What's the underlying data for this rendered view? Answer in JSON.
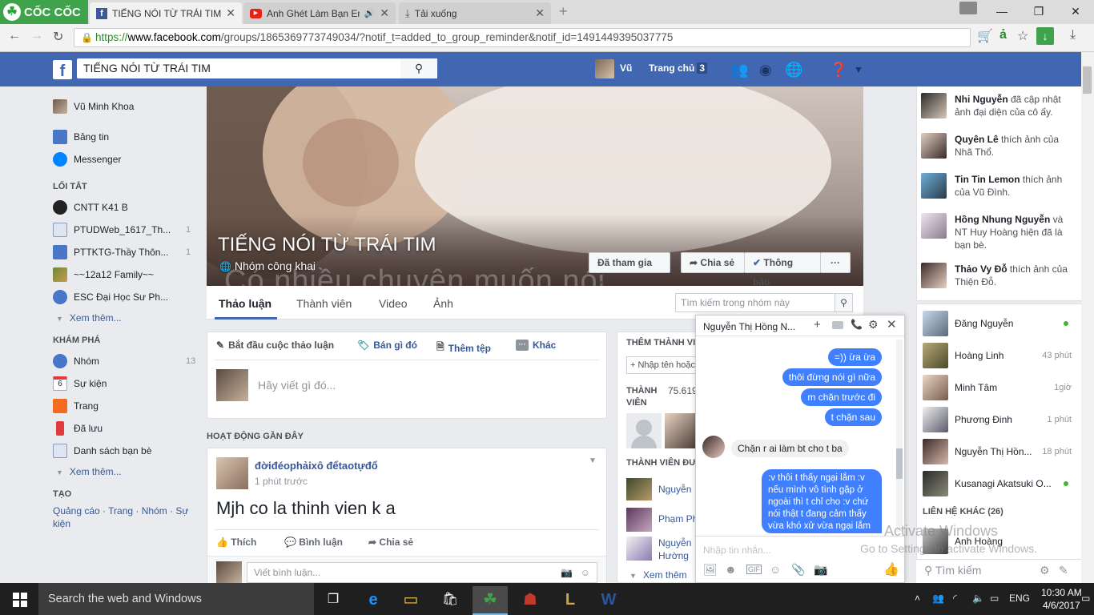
{
  "browser": {
    "brand": "CỐC CỐC",
    "tabs": [
      {
        "title": "TIẾNG NÓI TỪ TRÁI TIM",
        "icon": "facebook-icon"
      },
      {
        "title": "Anh Ghét Làm Bạn Em",
        "icon": "youtube-icon"
      },
      {
        "title": "Tải xuống",
        "icon": "download-icon"
      }
    ],
    "url_prefix": "https://",
    "url_host": "www.facebook.com",
    "url_path": "/groups/1865369773749034/?notif_t=added_to_group_reminder&notif_id=1491449395037775"
  },
  "fb": {
    "search_value": "TIẾNG NÓI TỪ TRÁI TIM",
    "user_short": "Vũ",
    "home": "Trang chủ",
    "home_count": "3"
  },
  "left_nav": {
    "profile": "Vũ Minh Khoa",
    "feed": "Bảng tin",
    "messenger": "Messenger",
    "shortcuts_header": "LỐI TẮT",
    "shortcuts": [
      {
        "label": "CNTT K41 B",
        "count": ""
      },
      {
        "label": "PTUDWeb_1617_Th...",
        "count": "1"
      },
      {
        "label": "PTTKTG-Thầy Thôn...",
        "count": "1"
      },
      {
        "label": "~~12a12 Family~~",
        "count": ""
      },
      {
        "label": "ESC Đại Học Sư Ph...",
        "count": ""
      }
    ],
    "see_more": "Xem thêm...",
    "explore_header": "KHÁM PHÁ",
    "explore": [
      {
        "label": "Nhóm",
        "count": "13"
      },
      {
        "label": "Sự kiện",
        "count": ""
      },
      {
        "label": "Trang",
        "count": ""
      },
      {
        "label": "Đã lưu",
        "count": ""
      },
      {
        "label": "Danh sách bạn bè",
        "count": ""
      }
    ],
    "calendar_day": "6",
    "create_header": "TẠO",
    "create_links": "Quảng cáo · Trang · Nhóm · Sự kiện"
  },
  "group": {
    "name": "TIẾNG NÓI TỪ TRÁI TIM",
    "type": "Nhóm công khai",
    "cover_text": "Có nhiều chuyện muốn nói",
    "joined_btn": "Đã tham gia",
    "share_btn": "Chia sẻ",
    "notify_btn": "Thông báo",
    "more_btn": "···",
    "tabs": [
      "Thảo luận",
      "Thành viên",
      "Video",
      "Ảnh"
    ],
    "search_placeholder": "Tìm kiếm trong nhóm này"
  },
  "composer": {
    "actions": [
      "Bắt đầu cuộc thảo luận",
      "Bán gì đó",
      "Thêm tệp",
      "Khác"
    ],
    "placeholder": "Hãy viết gì đó..."
  },
  "recent_activity": "HOẠT ĐỘNG GẦN ĐÂY",
  "post": {
    "author": "đờiđéophảixô đểtaotựđổ",
    "time": "1 phút trước",
    "text": "Mjh co la thinh vien k a",
    "like": "Thích",
    "comment": "Bình luận",
    "share": "Chia sẻ",
    "comment_placeholder": "Viết bình luận..."
  },
  "members": {
    "add_title": "THÊM THÀNH VI",
    "add_placeholder": "+ Nhập tên hoặc",
    "count_label": "THÀNH VIÊN",
    "count": "75.619",
    "friends_title": "THÀNH VIÊN ĐƯ",
    "friends": [
      "Nguyễn",
      "Phạm Ph",
      "Nguyễn Hường"
    ],
    "see_more": "Xem thêm"
  },
  "ticker": [
    {
      "name": "Nhi Nguyễn",
      "text": " đã cập nhật ảnh đại diện của cô ấy."
    },
    {
      "name": "Quyên Lê",
      "text": " thích ảnh của Nhã Thổ."
    },
    {
      "name": "Tin Tin Lemon",
      "text": " thích ảnh của Vũ Đình."
    },
    {
      "name": "Hồng Nhung Nguyễn",
      "text": " và NT Huy Hoàng hiện đã là bạn bè."
    },
    {
      "name": "Thảo Vy Đỗ",
      "text": " thích ảnh của Thiện Đỗ."
    }
  ],
  "friends_online": [
    {
      "name": "Đăng Nguyễn",
      "time": "",
      "online": true
    },
    {
      "name": "Hoàng Linh",
      "time": "43 phút",
      "online": false
    },
    {
      "name": "Minh Tâm",
      "time": "1giờ",
      "online": false
    },
    {
      "name": "Phương Đinh",
      "time": "1 phút",
      "online": false
    },
    {
      "name": "Nguyễn Thị Hồn...",
      "time": "18 phút",
      "online": false
    },
    {
      "name": "Kusanagi Akatsuki O...",
      "time": "",
      "online": true
    }
  ],
  "other_contacts": "LIÊN HỆ KHÁC (26)",
  "other_contact_1": "Anh Hoàng",
  "sidebar_search": "Tìm kiếm",
  "chat": {
    "title": "Nguyễn Thị Hồng N...",
    "messages": [
      {
        "from": "me",
        "text": "=)) ừa ừa"
      },
      {
        "from": "me",
        "text": "thôi đừng nói gì nữa"
      },
      {
        "from": "me",
        "text": "m chặn trước đi"
      },
      {
        "from": "me",
        "text": "t chặn sau"
      },
      {
        "from": "them",
        "text": "Chặn r ai làm bt cho t ba"
      },
      {
        "from": "me",
        "text": ":v thôi t thấy ngại lắm :v nếu mình vô tình gặp ở ngoài thì t chỉ cho :v chứ nói thật t đang cảm thấy vừa khó xử vừa ngại lắm"
      }
    ],
    "input_placeholder": "Nhập tin nhắn..."
  },
  "watermark": {
    "line1": "Activate Windows",
    "line2": "Go to Settings to activate Windows."
  },
  "taskbar": {
    "search": "Search the web and Windows",
    "lang": "ENG",
    "time": "10:30 AM",
    "date": "4/6/2017"
  }
}
